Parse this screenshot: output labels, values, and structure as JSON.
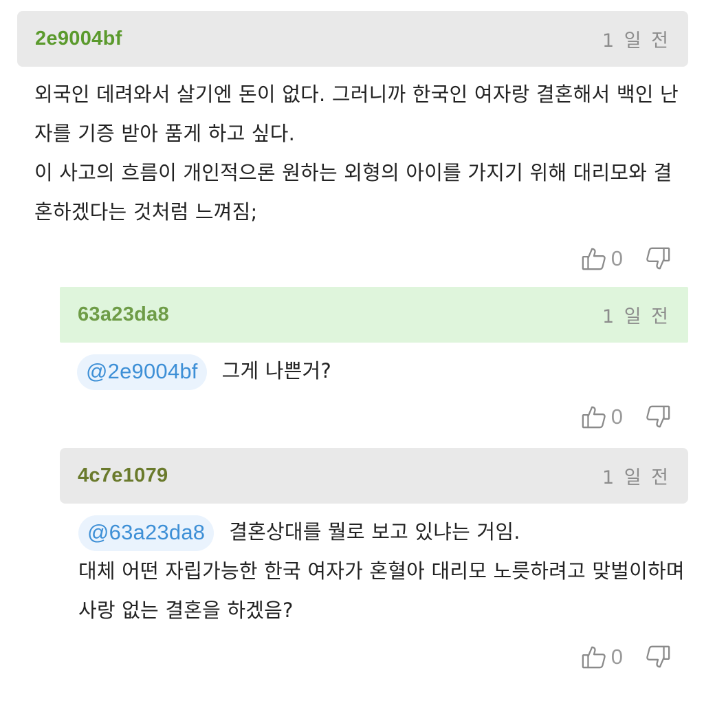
{
  "comments": [
    {
      "author": "2e9004bf",
      "time": "1 일 전",
      "mention": "",
      "body": "외국인 데려와서 살기엔 돈이 없다. 그러니까 한국인 여자랑 결혼해서 백인 난자를 기증 받아 품게 하고 싶다.\n이 사고의 흐름이 개인적으론 원하는 외형의 아이를 가지기 위해 대리모와 결혼하겠다는 것처럼 느껴짐;",
      "likes": "0"
    },
    {
      "author": "63a23da8",
      "time": "1 일 전",
      "mention": "@2e9004bf",
      "body": "그게 나쁜거?",
      "likes": "0"
    },
    {
      "author": "4c7e1079",
      "time": "1 일 전",
      "mention": "@63a23da8",
      "body": "결혼상대를 뭘로 보고 있냐는 거임.\n대체 어떤 자립가능한 한국 여자가 혼혈아 대리모 노릇하려고 맞벌이하며 사랑 없는 결혼을 하겠음?",
      "likes": "0"
    }
  ],
  "icons": {
    "like": "thumbs-up-icon",
    "dislike": "thumbs-down-icon"
  },
  "colors": {
    "mention_text": "#3d8fd6",
    "mention_bg": "#eaf3fd",
    "author_green": "#5b9a2d",
    "reply_header_bg": "#dff5dc",
    "header_bg": "#e9e9e9"
  }
}
